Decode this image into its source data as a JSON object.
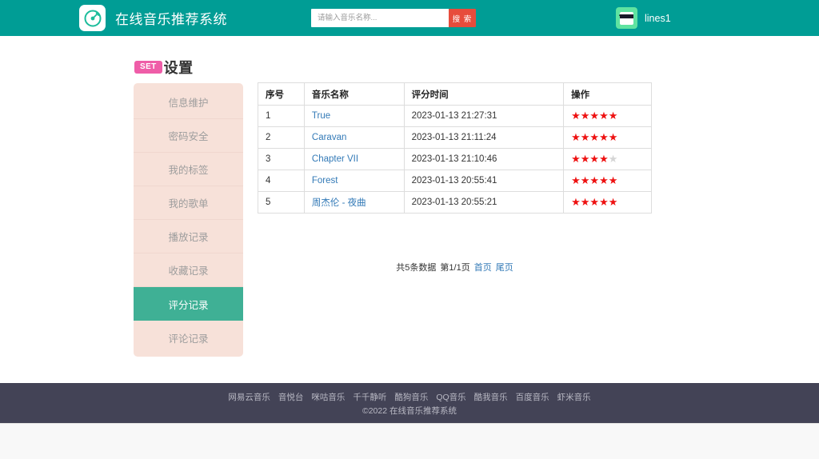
{
  "header": {
    "logo_icon": "music-disc-icon",
    "brand_title": "在线音乐推荐系统",
    "search": {
      "placeholder": "请输入音乐名称...",
      "value": "",
      "button_label": "搜 索"
    },
    "user": {
      "avatar_icon": "sunglasses-avatar-icon",
      "username": "lines1"
    },
    "bg_color": "#009d95",
    "search_button_color": "#e74c3c"
  },
  "page_title": {
    "badge": "SET",
    "badge_color": "#ef5da8",
    "text": "设置"
  },
  "sidebar": {
    "bg_color": "#f7e1d9",
    "active_color": "#3fb095",
    "items": [
      {
        "label": "信息维护",
        "active": false
      },
      {
        "label": "密码安全",
        "active": false
      },
      {
        "label": "我的标签",
        "active": false
      },
      {
        "label": "我的歌单",
        "active": false
      },
      {
        "label": "播放记录",
        "active": false
      },
      {
        "label": "收藏记录",
        "active": false
      },
      {
        "label": "评分记录",
        "active": true
      },
      {
        "label": "评论记录",
        "active": false
      }
    ]
  },
  "table": {
    "columns": [
      "序号",
      "音乐名称",
      "评分时间",
      "操作"
    ],
    "rows": [
      {
        "index": "1",
        "name": "True",
        "time": "2023-01-13 21:27:31",
        "rating": 5
      },
      {
        "index": "2",
        "name": "Caravan",
        "time": "2023-01-13 21:11:24",
        "rating": 5
      },
      {
        "index": "3",
        "name": "Chapter VII",
        "time": "2023-01-13 21:10:46",
        "rating": 4
      },
      {
        "index": "4",
        "name": "Forest",
        "time": "2023-01-13 20:55:41",
        "rating": 5
      },
      {
        "index": "5",
        "name": "周杰伦 - 夜曲",
        "time": "2023-01-13 20:55:21",
        "rating": 5
      }
    ],
    "max_stars": 5,
    "star_on_color": "#ee1111",
    "star_off_color": "#d5d5d5",
    "link_color": "#337ab7"
  },
  "pagination": {
    "total_text": "共5条数据",
    "page_text": "第1/1页",
    "first_page": "首页",
    "last_page": "尾页"
  },
  "footer": {
    "bg_color": "#434356",
    "links": [
      "网易云音乐",
      "音悦台",
      "咪咕音乐",
      "千千静听",
      "酷狗音乐",
      "QQ音乐",
      "酷我音乐",
      "百度音乐",
      "虾米音乐"
    ],
    "copyright": "©2022 在线音乐推荐系统"
  }
}
